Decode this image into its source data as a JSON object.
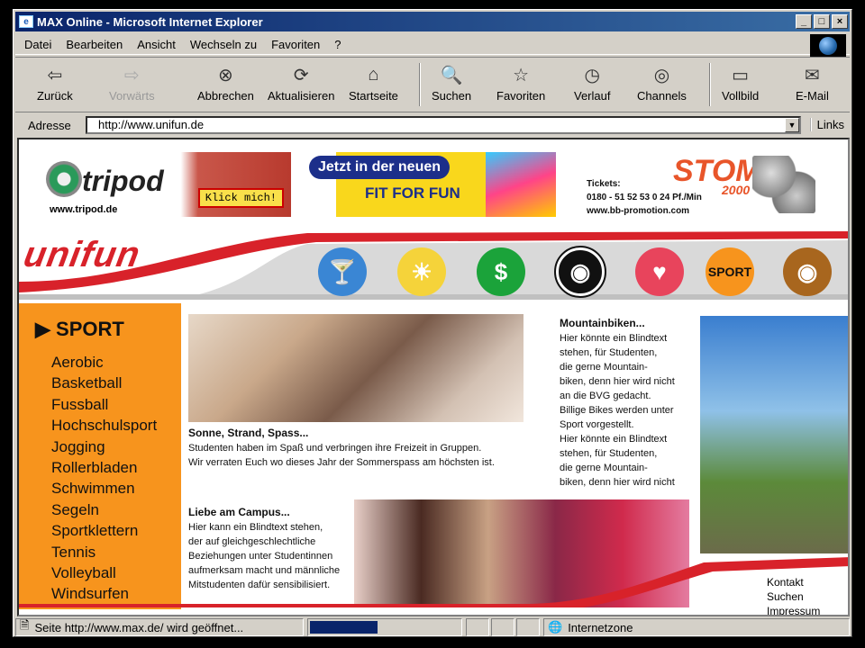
{
  "window": {
    "title": "MAX Online - Microsoft Internet Explorer"
  },
  "menu": [
    "Datei",
    "Bearbeiten",
    "Ansicht",
    "Wechseln zu",
    "Favoriten",
    "?"
  ],
  "toolbar": [
    {
      "label": "Zurück",
      "icon": "back-arrow-icon",
      "glyph": "⇦",
      "enabled": true
    },
    {
      "label": "Vorwärts",
      "icon": "forward-arrow-icon",
      "glyph": "⇨",
      "enabled": false
    },
    {
      "label": "Abbrechen",
      "icon": "stop-icon",
      "glyph": "⊗",
      "enabled": true
    },
    {
      "label": "Aktualisieren",
      "icon": "refresh-icon",
      "glyph": "⟳",
      "enabled": true
    },
    {
      "label": "Startseite",
      "icon": "home-icon",
      "glyph": "⌂",
      "enabled": true
    },
    {
      "label": "Suchen",
      "icon": "search-icon",
      "glyph": "🔍",
      "enabled": true
    },
    {
      "label": "Favoriten",
      "icon": "favorites-folder-icon",
      "glyph": "☆",
      "enabled": true
    },
    {
      "label": "Verlauf",
      "icon": "history-icon",
      "glyph": "◷",
      "enabled": true
    },
    {
      "label": "Channels",
      "icon": "channels-icon",
      "glyph": "◎",
      "enabled": true
    },
    {
      "label": "Vollbild",
      "icon": "fullscreen-icon",
      "glyph": "▭",
      "enabled": true
    },
    {
      "label": "E-Mail",
      "icon": "mail-icon",
      "glyph": "✉",
      "enabled": true
    }
  ],
  "address": {
    "label": "Adresse",
    "value": "http://www.unifun.de",
    "links": "Links"
  },
  "banners": {
    "tripod": {
      "name": "tripod",
      "url": "www.tripod.de",
      "button": "Klick mich!"
    },
    "fit": {
      "badge": "Jetzt in der neuen",
      "text": "FIT FOR FUN"
    },
    "stomp": {
      "title": "STOMP",
      "year": "2000",
      "tickets_label": "Tickets:",
      "tickets_phone": "0180 - 51 52 53 0 24 Pf./Min",
      "tickets_url": "www.bb-promotion.com"
    }
  },
  "logo": "unifun",
  "nav_circles": [
    {
      "name": "cocktail-icon",
      "glyph": "🍸",
      "color": "#3a86d4"
    },
    {
      "name": "sun-icon",
      "glyph": "☀",
      "color": "#f5d33a"
    },
    {
      "name": "dollar-icon",
      "glyph": "$",
      "color": "#1ba33a"
    },
    {
      "name": "record-icon",
      "glyph": "◉",
      "color": "#111111"
    },
    {
      "name": "heart-icon",
      "glyph": "♥",
      "color": "#e8445c"
    },
    {
      "name": "sport-icon",
      "glyph": "SPORT",
      "color": "#f7941d"
    },
    {
      "name": "eye-icon",
      "glyph": "◉",
      "color": "#a8661e"
    }
  ],
  "sidebar": {
    "heading": "SPORT",
    "items": [
      "Aerobic",
      "Basketball",
      "Fussball",
      "Hochschulsport",
      "Jogging",
      "Rollerbladen",
      "Schwimmen",
      "Segeln",
      "Sportklettern",
      "Tennis",
      "Volleyball",
      "Windsurfen"
    ]
  },
  "articles": {
    "beach": {
      "title": "Sonne, Strand, Spass...",
      "lines": [
        "Studenten haben im Spaß und verbringen ihre Freizeit in Gruppen.",
        "Wir verraten Euch wo dieses Jahr der Sommerspass am höchsten ist."
      ]
    },
    "bike": {
      "title": "Mountainbiken...",
      "lines": [
        "Hier könnte ein Blindtext",
        "stehen, für Studenten,",
        "die gerne Mountain-",
        "biken, denn hier wird nicht",
        "an die BVG gedacht.",
        "Billige Bikes werden unter",
        "Sport vorgestellt.",
        "Hier könnte ein Blindtext",
        "stehen, für Studenten,",
        "die gerne Mountain-",
        "biken, denn hier wird nicht"
      ]
    },
    "campus": {
      "title": "Liebe am Campus...",
      "lines": [
        "Hier kann ein Blindtext stehen,",
        "der auf gleichgeschlechtliche",
        "Beziehungen unter Studentinnen",
        "aufmerksam macht und männliche",
        "Mitstudenten dafür sensibilisiert."
      ]
    }
  },
  "footer_links": [
    "Kontakt",
    "Suchen",
    "Impressum"
  ],
  "status": {
    "text": "Seite http://www.max.de/ wird geöffnet...",
    "zone": "Internetzone",
    "progress": 0.45
  }
}
